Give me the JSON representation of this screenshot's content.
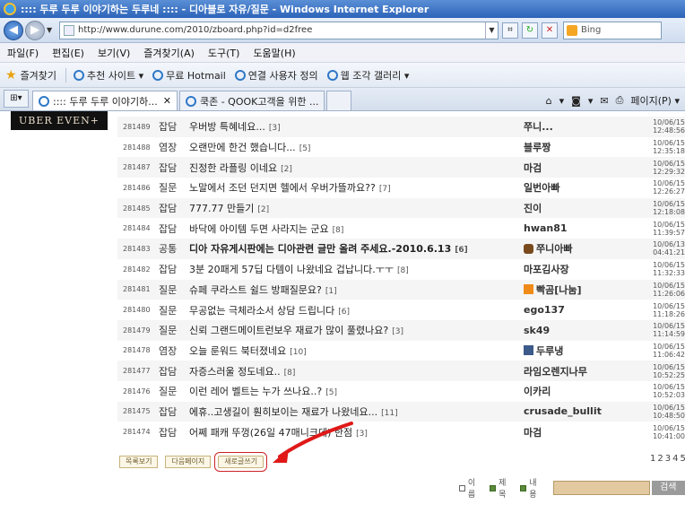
{
  "window": {
    "title": ":::: 두루 두루 이야기하는 두루네 :::: - 디아블로 자유/질문 - Windows Internet Explorer"
  },
  "address": {
    "url": "http://www.durune.com/2010/zboard.php?id=d2free",
    "search_placeholder": "Bing"
  },
  "menu": {
    "items": [
      "파일(F)",
      "편집(E)",
      "보기(V)",
      "즐겨찾기(A)",
      "도구(T)",
      "도움말(H)"
    ]
  },
  "favorites": {
    "label": "즐겨찾기",
    "items": [
      "추천 사이트 ▾",
      "무료 Hotmail",
      "연결 사용자 정의",
      "웹 조각 갤러리 ▾"
    ]
  },
  "tabs": {
    "items": [
      ":::: 두루 두루 이야기하...",
      "쿡존 - QOOK고객을 위한 ..."
    ],
    "tools": [
      "▾",
      "▾",
      "페이지(P) ▾"
    ]
  },
  "banner": {
    "text": "UBER EVEN+"
  },
  "board": {
    "rows": [
      {
        "num": "281489",
        "cat": "잡담",
        "subject": "우버방 특혜네요...",
        "comments": "[3]",
        "author": "쭈니...",
        "badge": "",
        "date": "10/06/15 12:48:56",
        "notice": false
      },
      {
        "num": "281488",
        "cat": "염장",
        "subject": "오랜만에 한건 했습니다...",
        "comments": "[5]",
        "author": "블루짱",
        "badge": "",
        "date": "10/06/15 12:35:18",
        "notice": false
      },
      {
        "num": "281487",
        "cat": "잡담",
        "subject": "진정한 라플링 이네요",
        "comments": "[2]",
        "author": "마검",
        "badge": "",
        "date": "10/06/15 12:29:32",
        "notice": false
      },
      {
        "num": "281486",
        "cat": "질문",
        "subject": "노말에서 조던 던지면 헬에서 우버가뜰까요??",
        "comments": "[7]",
        "author": "일번아빠",
        "badge": "",
        "date": "10/06/15 12:26:27",
        "notice": false
      },
      {
        "num": "281485",
        "cat": "잡담",
        "subject": "777.77 만들기",
        "comments": "[2]",
        "author": "진이",
        "badge": "",
        "date": "10/06/15 12:18:08",
        "notice": false
      },
      {
        "num": "281484",
        "cat": "잡담",
        "subject": "바닥에 아이템 두면 사라지는 군요",
        "comments": "[8]",
        "author": "hwan81",
        "badge": "",
        "date": "10/06/15 11:39:57",
        "notice": false
      },
      {
        "num": "281483",
        "cat": "공통",
        "subject": "디아 자유게시판에는 디아관련 글만 올려 주세요.-2010.6.13",
        "comments": "[6]",
        "author": "쭈니아빠",
        "badge": "hand",
        "date": "10/06/13 04:41:21",
        "notice": true
      },
      {
        "num": "281482",
        "cat": "잡담",
        "subject": "3분 20패게 57딥 다템이 나왔네요 겁납니다.ㅜㅜ",
        "comments": "[8]",
        "author": "마포김사장",
        "badge": "",
        "date": "10/06/15 11:32:33",
        "notice": false
      },
      {
        "num": "281481",
        "cat": "질문",
        "subject": "슈페 쿠라스트 쉴드 방패질문요?",
        "comments": "[1]",
        "author": "빡곰[나눔]",
        "badge": "n",
        "date": "10/06/15 11:26:06",
        "notice": false
      },
      {
        "num": "281480",
        "cat": "질문",
        "subject": "무공없는 극체라소서 상담 드립니다",
        "comments": "[6]",
        "author": "ego137",
        "badge": "",
        "date": "10/06/15 11:18:26",
        "notice": false
      },
      {
        "num": "281479",
        "cat": "질문",
        "subject": "신뢰 그랜드메이트런보우 재료가 많이 풀렸나요?",
        "comments": "[3]",
        "author": "sk49",
        "badge": "",
        "date": "10/06/15 11:14:59",
        "notice": false
      },
      {
        "num": "281478",
        "cat": "염장",
        "subject": "오늘 룬워드 북터졌네요",
        "comments": "[10]",
        "author": "두루냉",
        "badge": "blue",
        "date": "10/06/15 11:06:42",
        "notice": false
      },
      {
        "num": "281477",
        "cat": "잡담",
        "subject": "자증스러울 정도네요..",
        "comments": "[8]",
        "author": "라임오렌지나무",
        "badge": "",
        "date": "10/06/15 10:52:25",
        "notice": false
      },
      {
        "num": "281476",
        "cat": "질문",
        "subject": "이런 레어 벨트는 누가 쓰나요..?",
        "comments": "[5]",
        "author": "이카리",
        "badge": "",
        "date": "10/06/15 10:52:03",
        "notice": false
      },
      {
        "num": "281475",
        "cat": "잡담",
        "subject": "에휴..고생길이 훤히보이는 재료가 나왔네요...",
        "comments": "[11]",
        "author": "crusade_bullit",
        "badge": "",
        "date": "10/06/15 10:48:50",
        "notice": false
      },
      {
        "num": "281474",
        "cat": "잡담",
        "subject": "어쩨 패캐 뚜껑(26일 47매니크데) 한점",
        "comments": "[3]",
        "author": "마검",
        "badge": "",
        "date": "10/06/15 10:41:00",
        "notice": false
      }
    ],
    "buttons": {
      "list": "목록보기",
      "next": "다음페이지",
      "write": "새로글쓰기"
    },
    "pages": [
      "1",
      "2",
      "3",
      "4",
      "5"
    ],
    "search": {
      "name": "이름",
      "title": "제목",
      "content": "내용",
      "button": "검색"
    }
  }
}
